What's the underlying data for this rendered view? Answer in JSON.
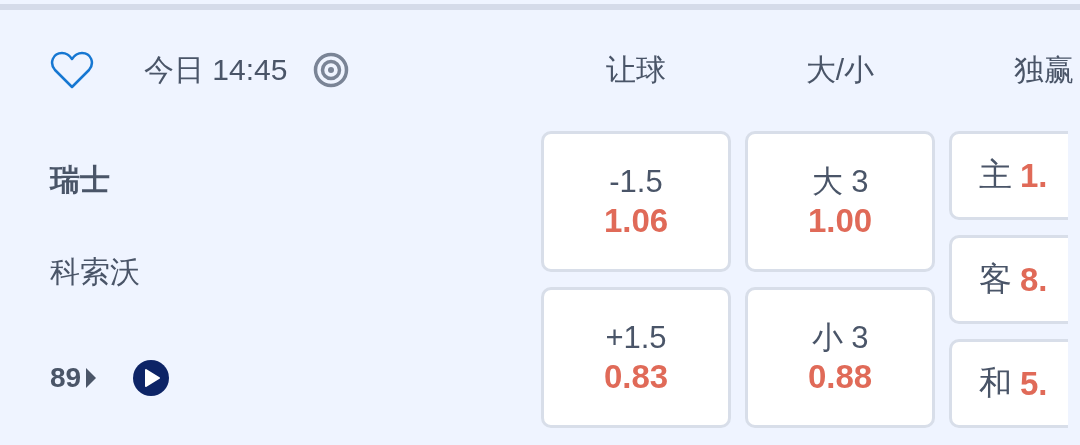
{
  "match": {
    "favorite": false,
    "time": "今日 14:45"
  },
  "columns": [
    "让球",
    "大/小",
    "独赢"
  ],
  "teams": [
    {
      "name": "瑞士",
      "highlighted": true
    },
    {
      "name": "科索沃",
      "highlighted": false
    }
  ],
  "markets_count": "89",
  "handicap": [
    {
      "label": "-1.5",
      "odds": "1.06"
    },
    {
      "label": "+1.5",
      "odds": "0.83"
    }
  ],
  "total": [
    {
      "label": "大 3",
      "odds": "1.00"
    },
    {
      "label": "小 3",
      "odds": "0.88"
    }
  ],
  "moneyline": [
    {
      "label": "主",
      "odds": "1."
    },
    {
      "label": "客",
      "odds": "8."
    },
    {
      "label": "和",
      "odds": "5."
    }
  ]
}
